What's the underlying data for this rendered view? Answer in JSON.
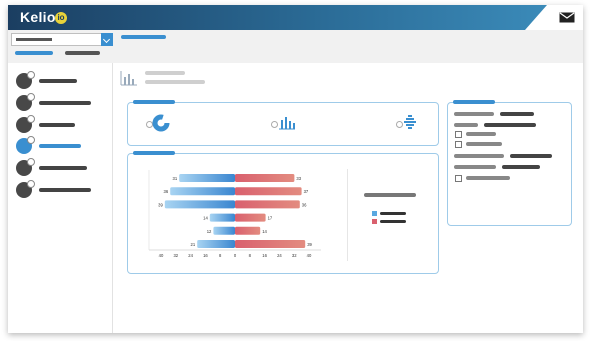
{
  "app": {
    "logo_text": "Kelio",
    "logo_badge": "io"
  },
  "header": {
    "select_value": "",
    "tabs": [
      "",
      ""
    ],
    "breadcrumb": ""
  },
  "sidebar": {
    "items": [
      {
        "icon": "network-icon",
        "label": "",
        "active": false
      },
      {
        "icon": "list-icon",
        "label": "",
        "active": false
      },
      {
        "icon": "stethoscope-icon",
        "label": "",
        "active": false
      },
      {
        "icon": "chart-icon",
        "label": "",
        "active": true
      },
      {
        "icon": "printer-icon",
        "label": "",
        "active": false
      },
      {
        "icon": "phone-icon",
        "label": "",
        "active": false
      }
    ]
  },
  "page": {
    "title": "",
    "subtitle": ""
  },
  "summary_card": {
    "tag": "",
    "options": [
      "donut-chart-icon",
      "bar-chart-icon",
      "pyramid-chart-icon"
    ]
  },
  "chart_card": {
    "tag": ""
  },
  "filter_card": {
    "tag": ""
  },
  "colors": {
    "accent": "#3a8fd0",
    "left_series": "#5aa8e0",
    "right_series": "#d9606e",
    "header_dark": "#1b3e61"
  },
  "chart_data": {
    "type": "bar",
    "orientation": "horizontal-diverging",
    "rows": [
      {
        "left": 31,
        "right": 33
      },
      {
        "left": 36,
        "right": 37
      },
      {
        "left": 39,
        "right": 36
      },
      {
        "left": 14,
        "right": 17
      },
      {
        "left": 12,
        "right": 14
      },
      {
        "left": 21,
        "right": 39
      }
    ],
    "x_ticks": [
      "40",
      "32",
      "24",
      "16",
      "8",
      "0",
      "8",
      "16",
      "24",
      "32",
      "40"
    ],
    "xlim": [
      -40,
      40
    ],
    "grid": false,
    "legend_position": "right"
  }
}
